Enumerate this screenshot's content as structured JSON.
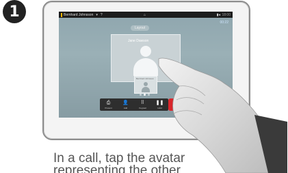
{
  "step_number": "1",
  "device": {
    "topbar": {
      "user_name": "Bernhard Johnsson",
      "time": "18:00"
    },
    "status_link": "00:22",
    "layout_button": "Layout",
    "main_video": {
      "participant_name": "Jane Dawson"
    },
    "pip": {
      "label": "Bernhard Johnsson"
    },
    "callbar": {
      "items": [
        {
          "icon": "present-icon",
          "glyph": "⎙",
          "label": "Present"
        },
        {
          "icon": "add-person-icon",
          "glyph": "👤",
          "label": "Add"
        },
        {
          "icon": "keypad-icon",
          "glyph": "⠿",
          "label": "Keypad"
        },
        {
          "icon": "hold-icon",
          "glyph": "❚❚",
          "label": "Hold"
        }
      ],
      "end_label": "End",
      "end_color": "#d9262b"
    }
  },
  "caption": {
    "line1": "In a call, tap the avatar",
    "line2": "representing the other"
  }
}
